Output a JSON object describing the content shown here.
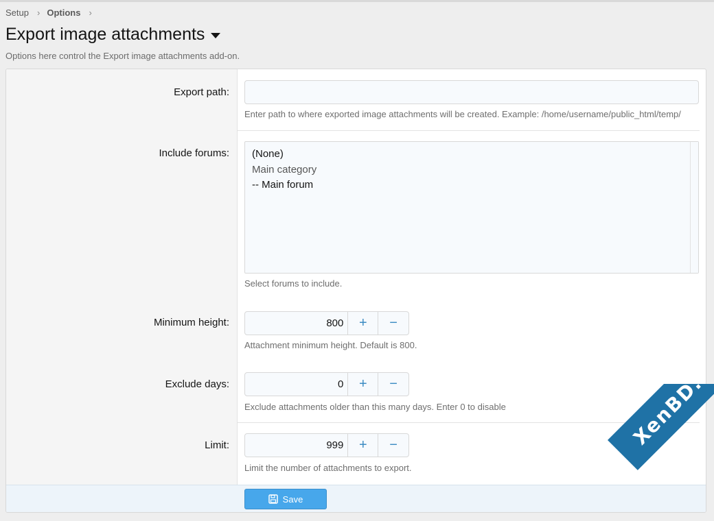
{
  "breadcrumb": {
    "items": [
      "Setup",
      "Options"
    ]
  },
  "header": {
    "title": "Export image attachments",
    "description": "Options here control the Export image attachments add-on."
  },
  "options": {
    "export_path": {
      "label": "Export path:",
      "value": "",
      "hint": "Enter path to where exported image attachments will be created. Example: /home/username/public_html/temp/"
    },
    "include_forums": {
      "label": "Include forums:",
      "options": [
        {
          "text": "(None)",
          "type": "option"
        },
        {
          "text": "Main category",
          "type": "group"
        },
        {
          "text": "-- Main forum",
          "type": "option"
        }
      ],
      "hint": "Select forums to include."
    },
    "min_height": {
      "label": "Minimum height:",
      "value": "800",
      "hint": "Attachment minimum height. Default is 800."
    },
    "exclude_days": {
      "label": "Exclude days:",
      "value": "0",
      "hint": "Exclude attachments older than this many days. Enter 0 to disable"
    },
    "limit": {
      "label": "Limit:",
      "value": "999",
      "hint": "Limit the number of attachments to export."
    }
  },
  "stepper": {
    "plus": "+",
    "minus": "−"
  },
  "footer": {
    "save_label": "Save"
  },
  "watermark": {
    "text": "XenBD.Com"
  },
  "colors": {
    "accent": "#47a7eb",
    "watermark": "#1f72a6"
  }
}
